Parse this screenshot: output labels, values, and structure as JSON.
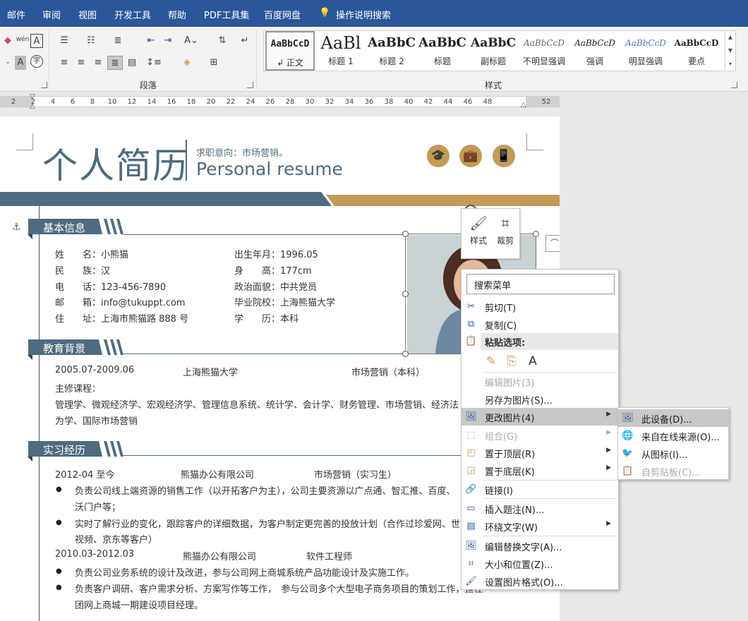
{
  "ribbon_tabs": [
    "邮件",
    "审阅",
    "视图",
    "开发工具",
    "帮助",
    "PDF工具集",
    "百度网盘",
    "操作说明搜索"
  ],
  "ribbon": {
    "group_paragraph": "段落",
    "group_styles": "样式",
    "styles": [
      {
        "sample": "AaBbCcD",
        "name": "↲ 正文"
      },
      {
        "sample": "AaBl",
        "name": "标题 1"
      },
      {
        "sample": "AaBbC",
        "name": "标题 2"
      },
      {
        "sample": "AaBbC",
        "name": "标题"
      },
      {
        "sample": "AaBbC",
        "name": "副标题"
      },
      {
        "sample": "AaBbCcD",
        "name": "不明显强调"
      },
      {
        "sample": "AaBbCcD",
        "name": "强调"
      },
      {
        "sample": "AaBbCcD",
        "name": "明显强调"
      },
      {
        "sample": "AaBbCcD",
        "name": "要点"
      }
    ],
    "font_tools": {
      "clear_format": "wén",
      "font_a": "A",
      "shade_a": "A",
      "circle_char": "字"
    }
  },
  "ruler": {
    "numbers": [
      "2",
      "2",
      "4",
      "6",
      "8",
      "10",
      "12",
      "14",
      "16",
      "18",
      "20",
      "22",
      "24",
      "26",
      "28",
      "30",
      "32",
      "34",
      "36",
      "38",
      "40",
      "42",
      "44",
      "46",
      "48",
      "52"
    ]
  },
  "resume": {
    "title_cn": "个人简历",
    "job_intent": "求职意向：市场营销。",
    "title_en": "Personal resume",
    "sections": {
      "basic": "基本信息",
      "education": "教育背景",
      "internship": "实习经历"
    },
    "basic_left": [
      "姓　　名：小熊猫",
      "民　　族：汉",
      "电　　话：123-456-7890",
      "邮　　箱：info@tukuppt.com",
      "住　　址：上海市熊猫路 888 号"
    ],
    "basic_right": [
      "出生年月：1996.05",
      "身　　高：177cm",
      "政治面貌：中共党员",
      "毕业院校：上海熊猫大学",
      "学　　历：本科"
    ],
    "edu_period": "2005.07-2009.06",
    "edu_school": "上海熊猫大学",
    "edu_major": "市场营销（本科）",
    "edu_courses_label": "主修课程：",
    "edu_courses_1": "管理学、微观经济学、宏观经济学、管理信息系统、统计学、会计学、财务管理、市场营销、经济法",
    "edu_courses_2": "为学、国际市场营销",
    "job1_period": "2012-04 至今",
    "job1_company": "熊猫办公有限公司",
    "job1_title": "市场营销（实习生）",
    "job1_b1_l1": "负责公司线上端资源的销售工作（以开拓客户为主），公司主要资源以广点通、智汇推、百度、",
    "job1_b1_l2": "沃门户等；",
    "job1_b2_l1": "实时了解行业的变化，跟踪客户的详细数据，为客户制定更完善的投放计划（合作过珍爱网、世",
    "job1_b2_l2": "视频、京东等客户）",
    "job2_period": "2010.03-2012.03",
    "job2_company": "熊猫办公有限公司",
    "job2_title": "软件工程师",
    "job2_b1": "负责公司业务系统的设计及改进，参与公司网上商城系统产品功能设计及实施工作。",
    "job2_b2_l1": "负责客户调研、客户需求分析、方案写作等工作，　参与公司多个大型电子商务项目的策划工作，担任",
    "job2_b2_l2": "团网上商城一期建设项目经理。"
  },
  "mini_toolbar": {
    "style": "样式",
    "crop": "裁剪"
  },
  "context_menu": {
    "search": "搜索菜单",
    "cut": "剪切(T)",
    "copy": "复制(C)",
    "paste_options": "粘贴选项:",
    "edit_picture": "编辑图片(3)",
    "save_as_picture": "另存为图片(S)...",
    "change_picture": "更改图片(4)",
    "group": "组合(G)",
    "bring_to_front": "置于顶层(R)",
    "send_to_back": "置于底层(K)",
    "link": "链接(I)",
    "insert_caption": "插入题注(N)...",
    "wrap_text": "环绕文字(W)",
    "edit_alt_text": "编辑替换文字(A)...",
    "size_position": "大小和位置(Z)...",
    "format_picture": "设置图片格式(O)..."
  },
  "submenu": {
    "this_device": "此设备(D)...",
    "online": "来自在线来源(O)...",
    "from_icons": "从图标(I)...",
    "clipboard": "自剪贴板(C)..."
  },
  "colors": {
    "word_blue": "#2b579a",
    "resume_slate": "#4f6b7f",
    "resume_gold": "#c49a58"
  }
}
